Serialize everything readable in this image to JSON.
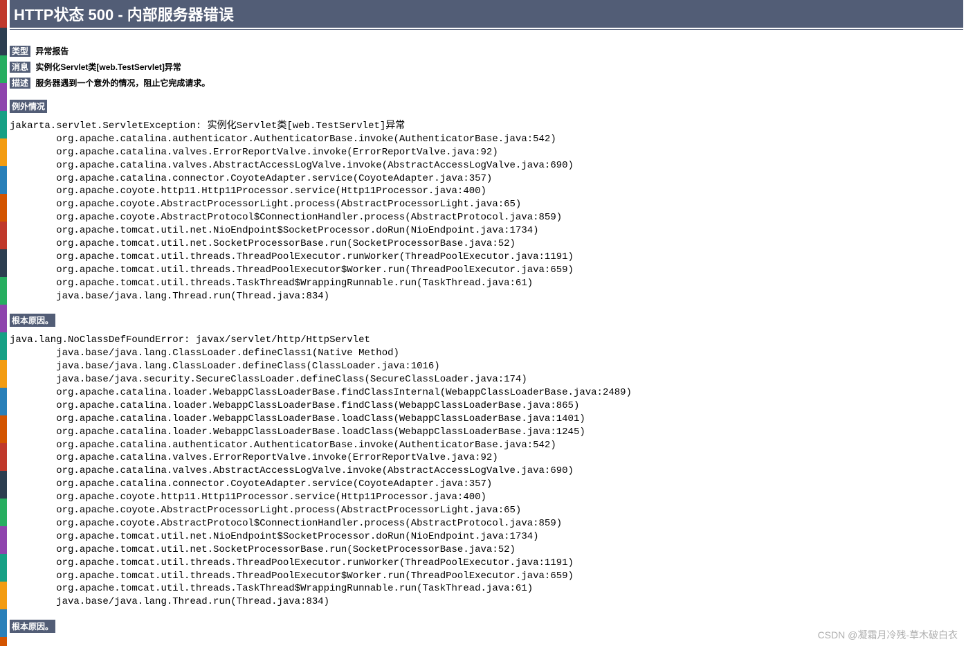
{
  "header": {
    "title": "HTTP状态 500 - 内部服务器错误"
  },
  "rows": {
    "type_label": "类型",
    "type_value": "异常报告",
    "message_label": "消息",
    "message_value": "实例化Servlet类[web.TestServlet]异常",
    "description_label": "描述",
    "description_value": "服务器遇到一个意外的情况，阻止它完成请求。"
  },
  "sections": {
    "exception_label": "例外情况",
    "exception_trace": "jakarta.servlet.ServletException: 实例化Servlet类[web.TestServlet]异常\n\torg.apache.catalina.authenticator.AuthenticatorBase.invoke(AuthenticatorBase.java:542)\n\torg.apache.catalina.valves.ErrorReportValve.invoke(ErrorReportValve.java:92)\n\torg.apache.catalina.valves.AbstractAccessLogValve.invoke(AbstractAccessLogValve.java:690)\n\torg.apache.catalina.connector.CoyoteAdapter.service(CoyoteAdapter.java:357)\n\torg.apache.coyote.http11.Http11Processor.service(Http11Processor.java:400)\n\torg.apache.coyote.AbstractProcessorLight.process(AbstractProcessorLight.java:65)\n\torg.apache.coyote.AbstractProtocol$ConnectionHandler.process(AbstractProtocol.java:859)\n\torg.apache.tomcat.util.net.NioEndpoint$SocketProcessor.doRun(NioEndpoint.java:1734)\n\torg.apache.tomcat.util.net.SocketProcessorBase.run(SocketProcessorBase.java:52)\n\torg.apache.tomcat.util.threads.ThreadPoolExecutor.runWorker(ThreadPoolExecutor.java:1191)\n\torg.apache.tomcat.util.threads.ThreadPoolExecutor$Worker.run(ThreadPoolExecutor.java:659)\n\torg.apache.tomcat.util.threads.TaskThread$WrappingRunnable.run(TaskThread.java:61)\n\tjava.base/java.lang.Thread.run(Thread.java:834)",
    "rootcause_label": "根本原因。",
    "rootcause_trace": "java.lang.NoClassDefFoundError: javax/servlet/http/HttpServlet\n\tjava.base/java.lang.ClassLoader.defineClass1(Native Method)\n\tjava.base/java.lang.ClassLoader.defineClass(ClassLoader.java:1016)\n\tjava.base/java.security.SecureClassLoader.defineClass(SecureClassLoader.java:174)\n\torg.apache.catalina.loader.WebappClassLoaderBase.findClassInternal(WebappClassLoaderBase.java:2489)\n\torg.apache.catalina.loader.WebappClassLoaderBase.findClass(WebappClassLoaderBase.java:865)\n\torg.apache.catalina.loader.WebappClassLoaderBase.loadClass(WebappClassLoaderBase.java:1401)\n\torg.apache.catalina.loader.WebappClassLoaderBase.loadClass(WebappClassLoaderBase.java:1245)\n\torg.apache.catalina.authenticator.AuthenticatorBase.invoke(AuthenticatorBase.java:542)\n\torg.apache.catalina.valves.ErrorReportValve.invoke(ErrorReportValve.java:92)\n\torg.apache.catalina.valves.AbstractAccessLogValve.invoke(AbstractAccessLogValve.java:690)\n\torg.apache.catalina.connector.CoyoteAdapter.service(CoyoteAdapter.java:357)\n\torg.apache.coyote.http11.Http11Processor.service(Http11Processor.java:400)\n\torg.apache.coyote.AbstractProcessorLight.process(AbstractProcessorLight.java:65)\n\torg.apache.coyote.AbstractProtocol$ConnectionHandler.process(AbstractProtocol.java:859)\n\torg.apache.tomcat.util.net.NioEndpoint$SocketProcessor.doRun(NioEndpoint.java:1734)\n\torg.apache.tomcat.util.net.SocketProcessorBase.run(SocketProcessorBase.java:52)\n\torg.apache.tomcat.util.threads.ThreadPoolExecutor.runWorker(ThreadPoolExecutor.java:1191)\n\torg.apache.tomcat.util.threads.ThreadPoolExecutor$Worker.run(ThreadPoolExecutor.java:659)\n\torg.apache.tomcat.util.threads.TaskThread$WrappingRunnable.run(TaskThread.java:61)\n\tjava.base/java.lang.Thread.run(Thread.java:834)",
    "rootcause2_label": "根本原因。"
  },
  "watermark": "CSDN @凝霜月冷残-草木破白衣"
}
